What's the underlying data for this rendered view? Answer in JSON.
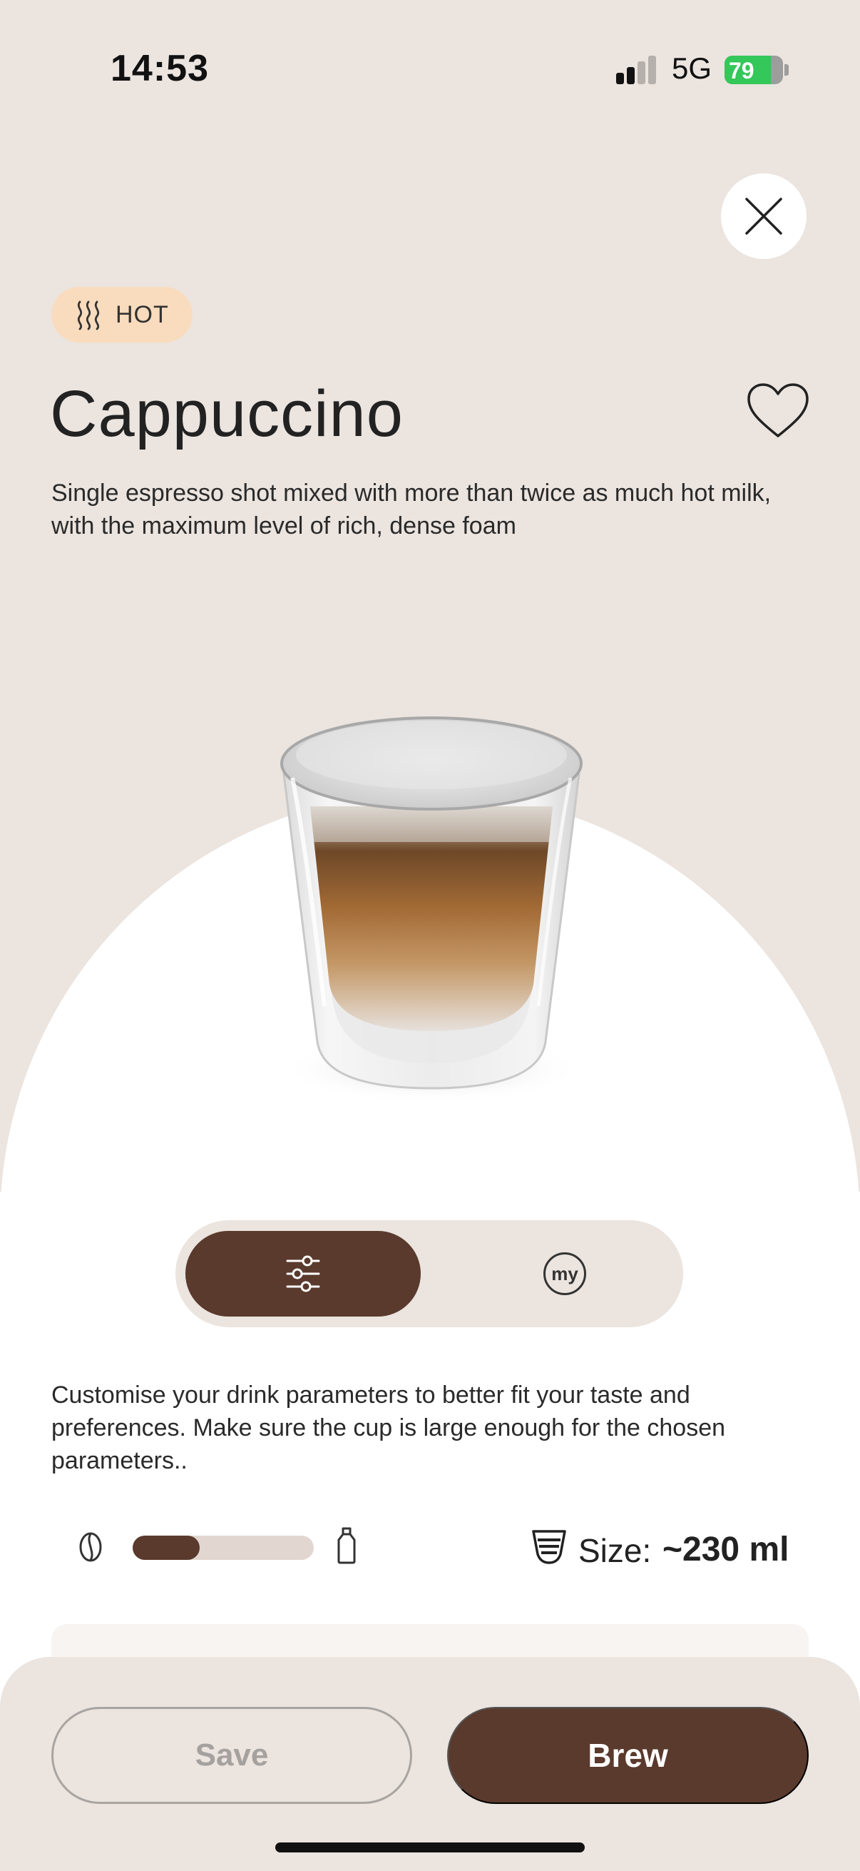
{
  "status_bar": {
    "time": "14:53",
    "network": "5G",
    "battery_level": "79",
    "battery_fraction": 0.79,
    "signal_bars_active": 2,
    "signal_bars_total": 4
  },
  "badge": {
    "label": "HOT",
    "icon": "steam-icon",
    "color": "#f9dcbd"
  },
  "drink": {
    "name": "Cappuccino",
    "description": "Single espresso shot mixed with more than twice as much hot milk, with the maximum level of rich, dense foam"
  },
  "mode_toggle": {
    "options": [
      {
        "icon": "sliders-icon",
        "active": true
      },
      {
        "icon": "my-icon",
        "label": "my",
        "active": false
      }
    ]
  },
  "customise_text": "Customise your drink parameters to better fit your taste and preferences. Make sure the cup is large enough for the chosen parameters..",
  "parameters": {
    "coffee_milk_ratio": 0.37,
    "size_label": "Size:",
    "size_value": "~230 ml"
  },
  "actions": {
    "save_label": "Save",
    "brew_label": "Brew"
  },
  "colors": {
    "background": "#ebe4df",
    "accent": "#5a3a2d",
    "badge": "#f9dcbd",
    "battery": "#34c759"
  }
}
